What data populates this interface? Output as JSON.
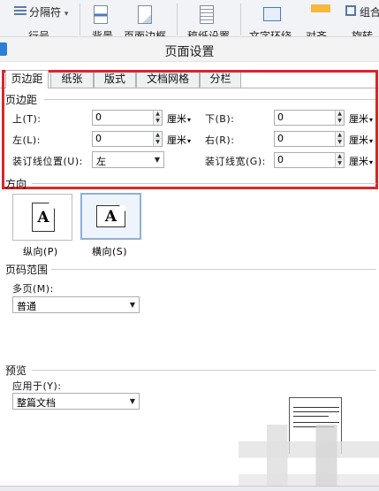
{
  "ribbon": {
    "page_break_label": "分隔符",
    "page_break_arrow": "▾",
    "row2_clipped": [
      "行号",
      "背景",
      "页面边框",
      "稿纸设置",
      "文字环绕",
      "对齐",
      "旋转"
    ],
    "group_label": "组合"
  },
  "dialog": {
    "title": "页面设置",
    "tabs": [
      "页边距",
      "纸张",
      "版式",
      "文档网格",
      "分栏"
    ],
    "margins": {
      "group_title": "页边距",
      "top_label": "上(T):",
      "top_value": "0",
      "bottom_label": "下(B):",
      "bottom_value": "0",
      "left_label": "左(L):",
      "left_value": "0",
      "right_label": "右(R):",
      "right_value": "0",
      "unit": "厘米",
      "gutter_pos_label": "装订线位置(U):",
      "gutter_pos_value": "左",
      "gutter_width_label": "装订线宽(G):",
      "gutter_width_value": "0"
    },
    "orientation": {
      "group_title": "方向",
      "icon_letter": "A",
      "portrait_label": "纵向(P)",
      "landscape_label": "横向(S)",
      "selected": "landscape"
    },
    "page_range": {
      "group_title": "页码范围",
      "multi_page_label": "多页(M):",
      "multi_page_value": "普通"
    },
    "preview": {
      "group_title": "预览",
      "apply_to_label": "应用于(Y):",
      "apply_to_value": "整篇文档"
    }
  },
  "colors": {
    "highlight_box": "#d9262a",
    "selected_orientation_border": "#8fb0d6"
  },
  "icons": {
    "spin_up": "▲",
    "spin_down": "▼",
    "dropdown": "▼",
    "unit_caret": "▾"
  }
}
